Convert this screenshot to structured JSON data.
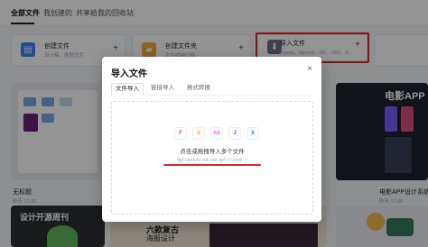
{
  "tabs": [
    "全部文件",
    "我创建的",
    "共享给我的",
    "回收站"
  ],
  "cards": [
    {
      "title": "创建文件",
      "subtitle": "设计稿、原型交互",
      "plus": "+"
    },
    {
      "title": "创建文件夹",
      "subtitle": "文件收纳归档",
      "plus": "+"
    },
    {
      "title": "导入文件",
      "subtitle": "Figma、Sketch、XD、JSD、A...",
      "plus": "+"
    }
  ],
  "files": [
    {
      "name": "无标题",
      "time": "昨天 21:35"
    },
    {
      "name": "电影APP设计系统...",
      "time": "昨天 17:09"
    }
  ],
  "thumbnails": {
    "left_mid": "设计开源周刊",
    "center": "六款复古",
    "center2": "海报设计",
    "right_mid": "设计",
    "right_top": "电影APP"
  },
  "modal": {
    "title": "导入文件",
    "close": "×",
    "tabs": [
      "文件导入",
      "链接导入",
      "格式转换"
    ],
    "drop_text": "点击或拖拽导入多个文件",
    "drop_hint": "fig/.sketch/.xd/.xd/.dp/ⓘ/.psd/ⓘ",
    "file_icons": [
      "F",
      "S",
      "Xd",
      "J",
      "X"
    ]
  },
  "colors": {
    "highlight": "#e0262b",
    "create_file": "#3b82f6",
    "folder": "#f4a93c",
    "import": "#6b7280"
  }
}
